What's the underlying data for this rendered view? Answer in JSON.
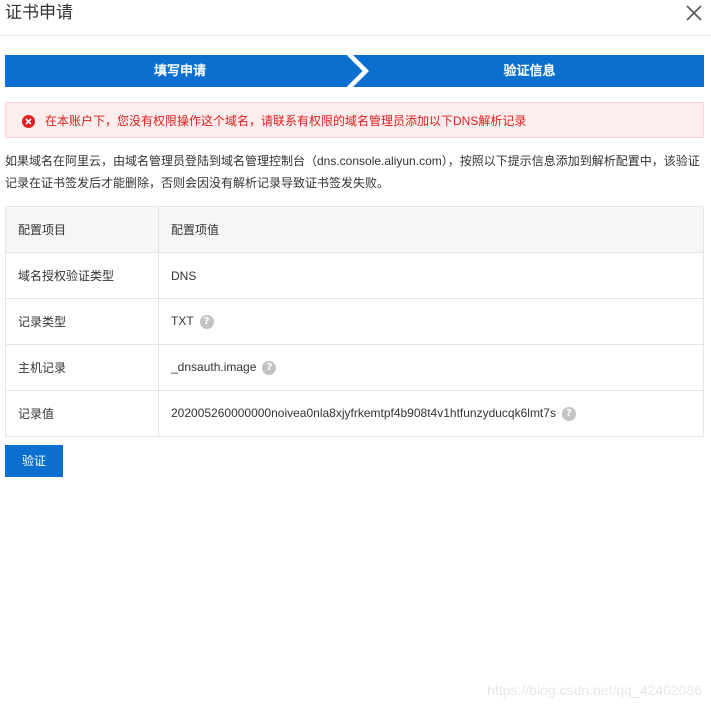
{
  "dialog": {
    "title": "证书申请",
    "close_icon": "close-icon"
  },
  "steps": [
    {
      "label": "填写申请"
    },
    {
      "label": "验证信息"
    }
  ],
  "colors": {
    "primary": "#0a6fce",
    "alert_bg": "#fdeded",
    "alert_text": "#e02020"
  },
  "alert": {
    "icon": "error-icon",
    "text": "在本账户下，您没有权限操作这个域名，请联系有权限的域名管理员添加以下DNS解析记录"
  },
  "description": "如果域名在阿里云，由域名管理员登陆到域名管理控制台（dns.console.aliyun.com），按照以下提示信息添加到解析配置中，该验证记录在证书签发后才能删除，否则会因没有解析记录导致证书签发失败。",
  "table": {
    "headers": {
      "key": "配置项目",
      "value": "配置项值"
    },
    "rows": [
      {
        "key": "域名授权验证类型",
        "value": "DNS",
        "help": false
      },
      {
        "key": "记录类型",
        "value": "TXT",
        "help": true
      },
      {
        "key": "主机记录",
        "value": "_dnsauth.image",
        "help": true
      },
      {
        "key": "记录值",
        "value": "202005260000000noivea0nla8xjyfrkemtpf4b908t4v1htfunzyducqk6lmt7s",
        "help": true
      }
    ],
    "help_glyph": "?"
  },
  "actions": {
    "verify_label": "验证"
  },
  "watermark": "https://blog.csdn.net/qq_42402086"
}
